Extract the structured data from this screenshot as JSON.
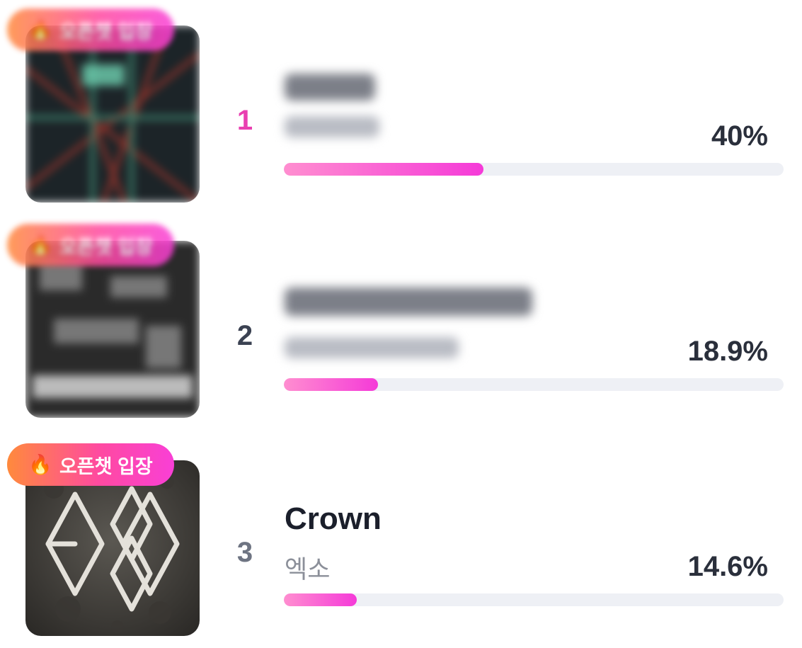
{
  "badge": {
    "icon": "fire-icon",
    "label": "오픈챗 입장"
  },
  "colors": {
    "accent": "#f53ad8",
    "rank1": "#e93fb1",
    "rank_other": "#3b4252"
  },
  "items": [
    {
      "rank": "1",
      "title": "",
      "artist": "",
      "percent_label": "40%",
      "percent": 40.0
    },
    {
      "rank": "2",
      "title": "",
      "artist": "",
      "percent_label": "18.9%",
      "percent": 18.9
    },
    {
      "rank": "3",
      "title": "Crown",
      "artist": "엑소",
      "percent_label": "14.6%",
      "percent": 14.6
    }
  ]
}
